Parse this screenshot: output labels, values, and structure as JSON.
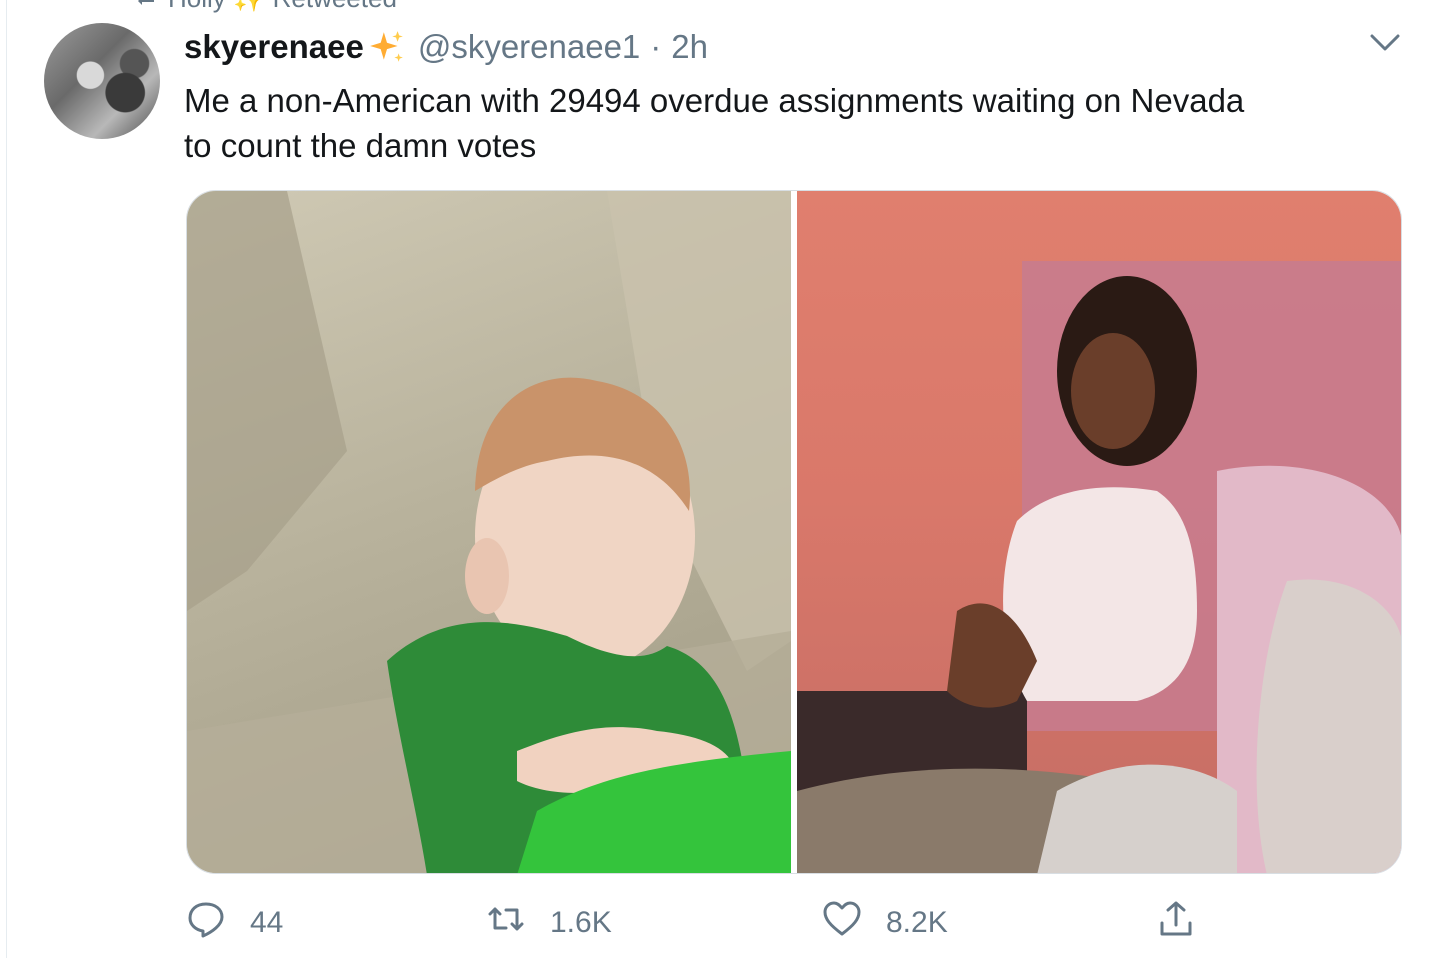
{
  "retweet_context": {
    "text": "Holly ✨ Retweeted",
    "icon": "retweet-icon"
  },
  "tweet": {
    "display_name": "skyerenaee",
    "name_emoji": "sparkles-icon",
    "handle": "@skyerenaee1",
    "separator": "·",
    "time": "2h",
    "text": "Me a non-American with 29494 overdue assignments waiting on Nevada\nto count the damn votes",
    "media": [
      {
        "description_icon": "photo-child-arms-crossed"
      },
      {
        "description_icon": "photo-woman-sitting-on-bed"
      }
    ]
  },
  "actions": {
    "reply_count": "44",
    "retweet_count": "1.6K",
    "like_count": "8.2K"
  },
  "colors": {
    "text_primary": "#14171a",
    "text_secondary": "#657786",
    "sparkle": "#ffac33",
    "border": "#e6ecf0"
  }
}
